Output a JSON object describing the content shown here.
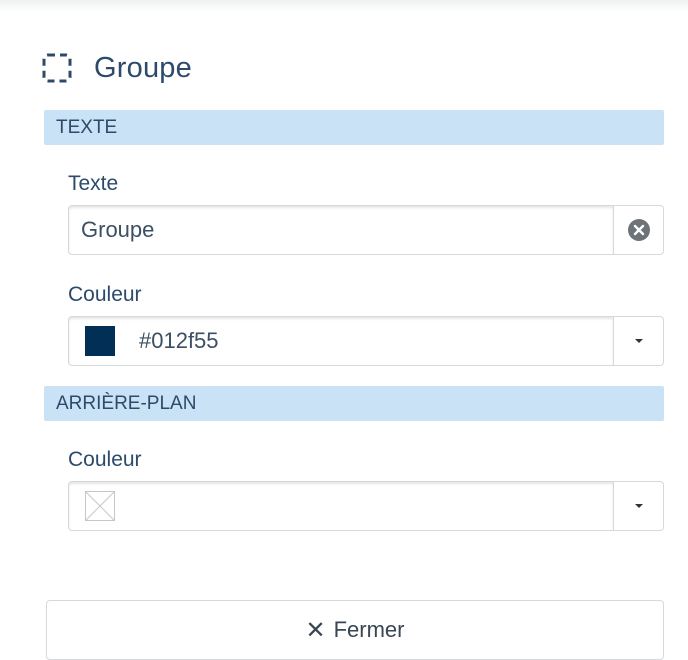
{
  "header": {
    "title": "Groupe",
    "icon": "dashed-square-icon"
  },
  "sections": {
    "text": {
      "heading": "TEXTE",
      "text_label": "Texte",
      "text_value": "Groupe",
      "color_label": "Couleur",
      "color_value": "#012f55",
      "swatch_color": "#012f55"
    },
    "background": {
      "heading": "ARRIÈRE-PLAN",
      "color_label": "Couleur",
      "color_value": ""
    }
  },
  "footer": {
    "close_label": "Fermer"
  },
  "colors": {
    "section_header_bg": "#c9e2f6",
    "title_text": "#2d4a6a"
  }
}
